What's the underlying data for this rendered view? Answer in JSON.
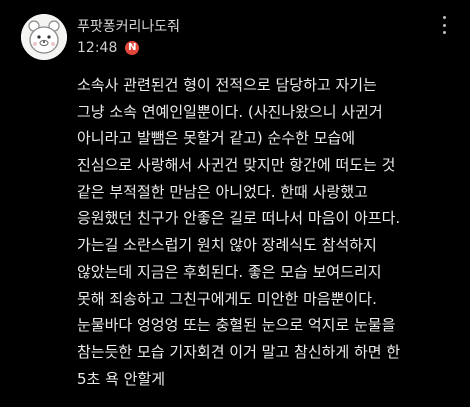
{
  "comment": {
    "username": "푸팟퐁커리나도줘",
    "time": "12:48",
    "badge": "N",
    "badge_color": "#e0463a",
    "lines": [
      "소속사 관련된건 형이 전적으로 담당하고 자기는",
      "그냥 소속 연예인일뿐이다. (사진나왔으니 사귄거",
      "아니라고 발뺌은 못할거 같고) 순수한 모습에",
      "진심으로 사랑해서 사귄건 맞지만 항간에 떠도는 것",
      "같은 부적절한 만남은 아니었다. 한때 사랑했고",
      "응원했던 친구가 안좋은 길로 떠나서 마음이 아프다.",
      "가는길 소란스럽기 원치 않아 장례식도 참석하지",
      "않았는데 지금은 후회된다. 좋은 모습 보여드리지",
      "못해 죄송하고 그친구에게도 미안한 마음뿐이다.",
      "눈물바다 엉엉엉 또는 충혈된 눈으로 억지로 눈물을",
      "참는듯한 모습 기자회견 이거 말고 참신하게 하면 한",
      "5초 욕 안할게"
    ]
  },
  "icons": {
    "avatar": "cartoon-bear-avatar",
    "more": "vertical-ellipsis-icon"
  }
}
